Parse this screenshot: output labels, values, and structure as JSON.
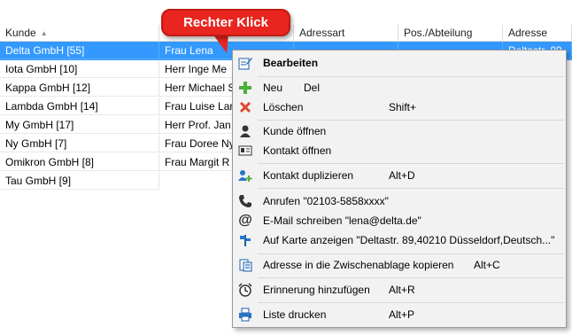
{
  "table": {
    "headers": [
      "Kunde",
      "",
      "Adressart",
      "Pos./Abteilung",
      "Adresse"
    ],
    "rows": [
      [
        "Delta GmbH [55]",
        "Frau Lena",
        "",
        "",
        "Deltastr. 89"
      ],
      [
        "Iota GmbH [10]",
        "Herr Inge Me",
        "",
        "",
        ""
      ],
      [
        "Kappa GmbH [12]",
        "Herr Michael S",
        "",
        "",
        ""
      ],
      [
        "Lambda GmbH [14]",
        "Frau Luise Lar",
        "",
        "",
        ""
      ],
      [
        "My GmbH [17]",
        "Herr Prof. Jan",
        "",
        "",
        ""
      ],
      [
        "Ny GmbH [7]",
        "Frau Doree Ny",
        "",
        "",
        ""
      ],
      [
        "Omikron GmbH [8]",
        "Frau Margit R",
        "",
        "",
        ""
      ],
      [
        "Tau GmbH [9]",
        "",
        "",
        "",
        ""
      ]
    ],
    "selected_row": 0
  },
  "callout": {
    "text": "Rechter Klick"
  },
  "context_menu": {
    "items": [
      {
        "label": "Bearbeiten",
        "shortcut": "",
        "icon": "edit-icon",
        "bold": true
      },
      {
        "label": "Neu",
        "shortcut": "Del",
        "icon": "plus-icon"
      },
      {
        "label": "Löschen",
        "shortcut": "Shift+",
        "icon": "delete-icon"
      },
      {
        "label": "Kunde öffnen",
        "shortcut": "",
        "icon": "person-icon"
      },
      {
        "label": "Kontakt öffnen",
        "shortcut": "",
        "icon": "contact-card-icon"
      },
      {
        "label": "Kontakt duplizieren",
        "shortcut": "Alt+D",
        "icon": "duplicate-contact-icon"
      },
      {
        "label": "Anrufen \"02103-5858xxxx\"",
        "shortcut": "",
        "icon": "phone-icon"
      },
      {
        "label": "E-Mail schreiben \"lena@delta.de\"",
        "shortcut": "",
        "icon": "email-at-icon"
      },
      {
        "label": "Auf Karte anzeigen \"Deltastr. 89,40210 Düsseldorf,Deutsch...\"",
        "shortcut": "",
        "icon": "map-pin-icon"
      },
      {
        "label": "Adresse in die Zwischenablage kopieren",
        "shortcut": "Alt+C",
        "icon": "clipboard-icon"
      },
      {
        "label": "Erinnerung hinzufügen",
        "shortcut": "Alt+R",
        "icon": "alarm-clock-icon"
      },
      {
        "label": "Liste drucken",
        "shortcut": "Alt+P",
        "icon": "printer-icon"
      }
    ]
  },
  "colors": {
    "selection": "#3399ff",
    "callout": "#e8251f"
  }
}
